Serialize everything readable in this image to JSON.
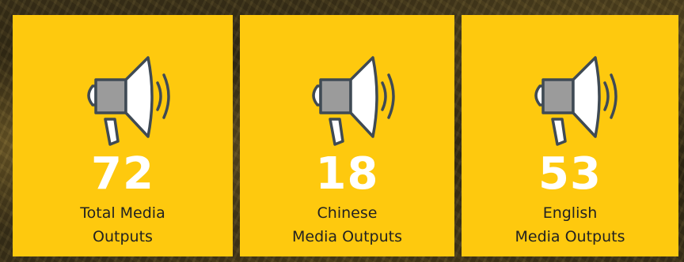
{
  "stats": [
    {
      "value": "72",
      "label_line1": "Total Media",
      "label_line2": "Outputs",
      "icon": "megaphone-icon"
    },
    {
      "value": "18",
      "label_line1": "Chinese",
      "label_line2": "Media Outputs",
      "icon": "megaphone-icon"
    },
    {
      "value": "53",
      "label_line1": "English",
      "label_line2": "Media Outputs",
      "icon": "megaphone-icon"
    }
  ],
  "colors": {
    "card_background": "#fec90e",
    "number_color": "#ffffff",
    "label_color": "#222222",
    "icon_stroke": "#3f4a54",
    "icon_body": "#9b9b9b",
    "icon_horn": "#ffffff"
  }
}
